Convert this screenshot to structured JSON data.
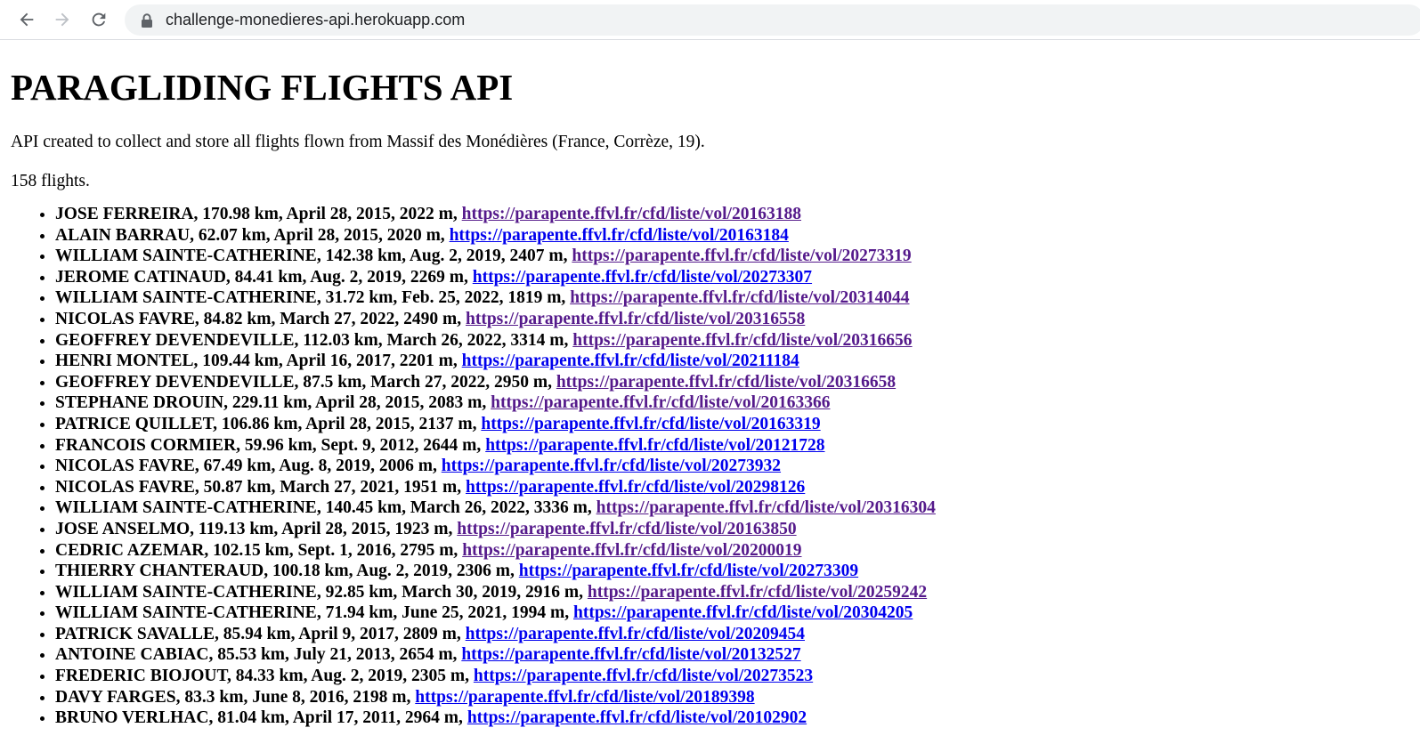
{
  "browser": {
    "url": "challenge-monedieres-api.herokuapp.com"
  },
  "page": {
    "title": "PARAGLIDING FLIGHTS API",
    "description": "API created to collect and store all flights flown from Massif des Monédières (France, Corrèze, 19).",
    "count": "158 flights."
  },
  "flights": [
    {
      "text": "JOSE FERREIRA, 170.98 km, April 28, 2015, 2022 m, ",
      "link": "https://parapente.ffvl.fr/cfd/liste/vol/20163188",
      "visited": true
    },
    {
      "text": "ALAIN BARRAU, 62.07 km, April 28, 2015, 2020 m, ",
      "link": "https://parapente.ffvl.fr/cfd/liste/vol/20163184",
      "visited": false
    },
    {
      "text": "WILLIAM SAINTE-CATHERINE, 142.38 km, Aug. 2, 2019, 2407 m, ",
      "link": "https://parapente.ffvl.fr/cfd/liste/vol/20273319",
      "visited": true
    },
    {
      "text": "JEROME CATINAUD, 84.41 km, Aug. 2, 2019, 2269 m, ",
      "link": "https://parapente.ffvl.fr/cfd/liste/vol/20273307",
      "visited": false
    },
    {
      "text": "WILLIAM SAINTE-CATHERINE, 31.72 km, Feb. 25, 2022, 1819 m, ",
      "link": "https://parapente.ffvl.fr/cfd/liste/vol/20314044",
      "visited": true
    },
    {
      "text": "NICOLAS FAVRE, 84.82 km, March 27, 2022, 2490 m, ",
      "link": "https://parapente.ffvl.fr/cfd/liste/vol/20316558",
      "visited": true
    },
    {
      "text": "GEOFFREY DEVENDEVILLE, 112.03 km, March 26, 2022, 3314 m, ",
      "link": "https://parapente.ffvl.fr/cfd/liste/vol/20316656",
      "visited": true
    },
    {
      "text": "HENRI MONTEL, 109.44 km, April 16, 2017, 2201 m, ",
      "link": "https://parapente.ffvl.fr/cfd/liste/vol/20211184",
      "visited": false
    },
    {
      "text": "GEOFFREY DEVENDEVILLE, 87.5 km, March 27, 2022, 2950 m, ",
      "link": "https://parapente.ffvl.fr/cfd/liste/vol/20316658",
      "visited": true
    },
    {
      "text": "STEPHANE DROUIN, 229.11 km, April 28, 2015, 2083 m, ",
      "link": "https://parapente.ffvl.fr/cfd/liste/vol/20163366",
      "visited": true
    },
    {
      "text": "PATRICE QUILLET, 106.86 km, April 28, 2015, 2137 m, ",
      "link": "https://parapente.ffvl.fr/cfd/liste/vol/20163319",
      "visited": false
    },
    {
      "text": "FRANCOIS CORMIER, 59.96 km, Sept. 9, 2012, 2644 m, ",
      "link": "https://parapente.ffvl.fr/cfd/liste/vol/20121728",
      "visited": false
    },
    {
      "text": "NICOLAS FAVRE, 67.49 km, Aug. 8, 2019, 2006 m, ",
      "link": "https://parapente.ffvl.fr/cfd/liste/vol/20273932",
      "visited": false
    },
    {
      "text": "NICOLAS FAVRE, 50.87 km, March 27, 2021, 1951 m, ",
      "link": "https://parapente.ffvl.fr/cfd/liste/vol/20298126",
      "visited": false
    },
    {
      "text": "WILLIAM SAINTE-CATHERINE, 140.45 km, March 26, 2022, 3336 m, ",
      "link": "https://parapente.ffvl.fr/cfd/liste/vol/20316304",
      "visited": true
    },
    {
      "text": "JOSE ANSELMO, 119.13 km, April 28, 2015, 1923 m, ",
      "link": "https://parapente.ffvl.fr/cfd/liste/vol/20163850",
      "visited": true
    },
    {
      "text": "CEDRIC AZEMAR, 102.15 km, Sept. 1, 2016, 2795 m, ",
      "link": "https://parapente.ffvl.fr/cfd/liste/vol/20200019",
      "visited": true
    },
    {
      "text": "THIERRY CHANTERAUD, 100.18 km, Aug. 2, 2019, 2306 m, ",
      "link": "https://parapente.ffvl.fr/cfd/liste/vol/20273309",
      "visited": false
    },
    {
      "text": "WILLIAM SAINTE-CATHERINE, 92.85 km, March 30, 2019, 2916 m, ",
      "link": "https://parapente.ffvl.fr/cfd/liste/vol/20259242",
      "visited": true
    },
    {
      "text": "WILLIAM SAINTE-CATHERINE, 71.94 km, June 25, 2021, 1994 m, ",
      "link": "https://parapente.ffvl.fr/cfd/liste/vol/20304205",
      "visited": false
    },
    {
      "text": "PATRICK SAVALLE, 85.94 km, April 9, 2017, 2809 m, ",
      "link": "https://parapente.ffvl.fr/cfd/liste/vol/20209454",
      "visited": false
    },
    {
      "text": "ANTOINE CABIAC, 85.53 km, July 21, 2013, 2654 m, ",
      "link": "https://parapente.ffvl.fr/cfd/liste/vol/20132527",
      "visited": false
    },
    {
      "text": "FREDERIC BIOJOUT, 84.33 km, Aug. 2, 2019, 2305 m, ",
      "link": "https://parapente.ffvl.fr/cfd/liste/vol/20273523",
      "visited": false
    },
    {
      "text": "DAVY FARGES, 83.3 km, June 8, 2016, 2198 m, ",
      "link": "https://parapente.ffvl.fr/cfd/liste/vol/20189398",
      "visited": false
    },
    {
      "text": "BRUNO VERLHAC, 81.04 km, April 17, 2011, 2964 m, ",
      "link": "https://parapente.ffvl.fr/cfd/liste/vol/20102902",
      "visited": false
    }
  ],
  "colors": {
    "link_unvisited": "#0000ee",
    "link_visited": "#551a8b",
    "omnibox_bg": "#f1f3f4"
  },
  "icons": {
    "back": "arrow-left-icon",
    "forward": "arrow-right-icon",
    "reload": "reload-icon",
    "lock": "lock-icon"
  }
}
